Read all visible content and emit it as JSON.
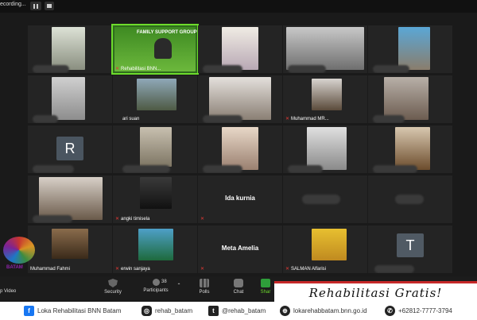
{
  "topbar": {
    "recording_label": "ecording..."
  },
  "tiles": [
    {
      "id": "r1c1",
      "name": "",
      "muted": true
    },
    {
      "id": "r1c2",
      "name": "Rehabilitasi BNN...",
      "muted": true,
      "banner": "FAMILY SUPPORT GROUP",
      "active": true
    },
    {
      "id": "r1c3",
      "name": "",
      "muted": true
    },
    {
      "id": "r1c4",
      "name": "",
      "muted": true
    },
    {
      "id": "r1c5",
      "name": "",
      "muted": true
    },
    {
      "id": "r2c1",
      "name": "",
      "muted": true
    },
    {
      "id": "r2c2",
      "name": "ari suan",
      "muted": false
    },
    {
      "id": "r2c3",
      "name": "",
      "muted": true
    },
    {
      "id": "r2c4",
      "name": "Muhammad MR...",
      "muted": true
    },
    {
      "id": "r2c5",
      "name": "",
      "muted": true
    },
    {
      "id": "r3c1",
      "name": "",
      "muted": true,
      "initial": "R"
    },
    {
      "id": "r3c2",
      "name": "",
      "muted": true
    },
    {
      "id": "r3c3",
      "name": "",
      "muted": true
    },
    {
      "id": "r3c4",
      "name": "",
      "muted": true
    },
    {
      "id": "r3c5",
      "name": "",
      "muted": true
    },
    {
      "id": "r4c1",
      "name": "",
      "muted": true
    },
    {
      "id": "r4c2",
      "name": "angki timisela",
      "muted": true
    },
    {
      "id": "r4c3",
      "name": "",
      "center_name": "Ida kurnia",
      "muted": true
    },
    {
      "id": "r4c4",
      "name": "",
      "muted": true
    },
    {
      "id": "r4c5",
      "name": "",
      "muted": true
    },
    {
      "id": "r5c1",
      "name": "Muhammad Fahmi",
      "muted": true
    },
    {
      "id": "r5c2",
      "name": "erwin sanjaya",
      "muted": true
    },
    {
      "id": "r5c3",
      "name": "",
      "center_name": "Meta Amelia",
      "muted": true
    },
    {
      "id": "r5c4",
      "name": "SALMAN Alfarisi",
      "muted": true
    },
    {
      "id": "r5c5",
      "name": "",
      "muted": true,
      "initial": "T"
    }
  ],
  "logo": {
    "year": "2020",
    "text": "BATAM"
  },
  "toolbar": {
    "video_label": "p Video",
    "security_label": "Security",
    "participants_label": "Participants",
    "participants_count": "38",
    "polls_label": "Polls",
    "chat_label": "Chat",
    "share_label": "Shar"
  },
  "promo": {
    "text": "Rehabilitasi Gratis!"
  },
  "footer": {
    "facebook": "Loka Rehabilitasi BNN Batam",
    "instagram": "rehab_batam",
    "twitter": "@rehab_batam",
    "website": "lokarehabbatam.bnn.go.id",
    "whatsapp": "+62812-7777-3794"
  },
  "colors": {
    "active_border": "#6ddc2c",
    "muted_icon": "#e53935",
    "promo_border": "#c62828"
  }
}
